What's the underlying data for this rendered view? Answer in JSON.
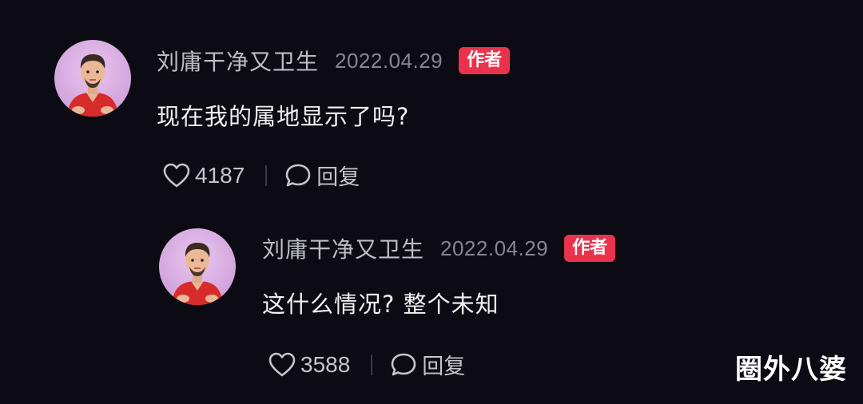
{
  "comments": [
    {
      "username": "刘庸干净又卫生",
      "date": "2022.04.29",
      "badge": "作者",
      "content": "现在我的属地显示了吗?",
      "likes": "4187",
      "reply_label": "回复",
      "avatar_icon": "cartoon-man-avatar",
      "like_icon": "heart-icon",
      "reply_icon": "speech-bubble-icon"
    },
    {
      "username": "刘庸干净又卫生",
      "date": "2022.04.29",
      "badge": "作者",
      "content": "这什么情况? 整个未知",
      "likes": "3588",
      "reply_label": "回复",
      "avatar_icon": "cartoon-man-avatar",
      "like_icon": "heart-icon",
      "reply_icon": "speech-bubble-icon"
    }
  ],
  "watermark": "圈外八婆",
  "colors": {
    "background": "#0c0b13",
    "badge": "#e9334d",
    "avatar_bg": "#d5a9df"
  }
}
